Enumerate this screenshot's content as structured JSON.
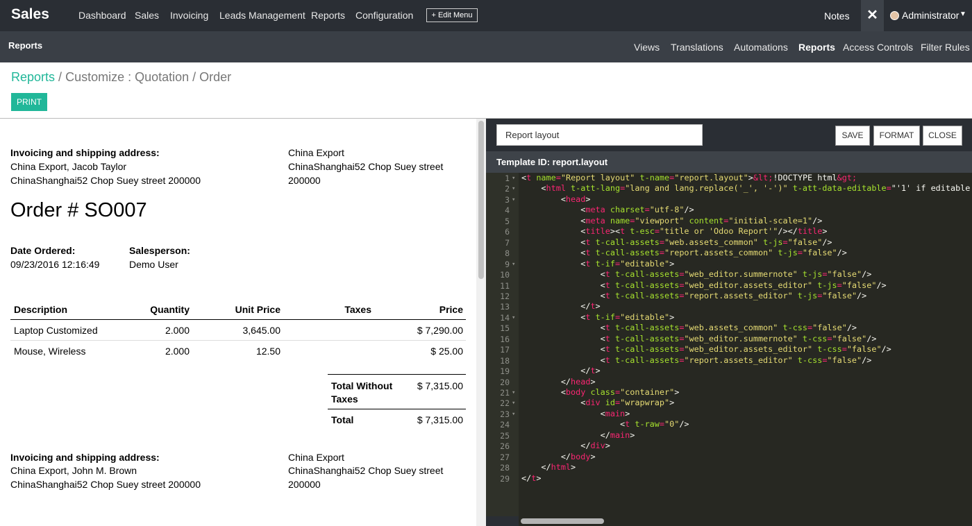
{
  "topbar": {
    "app_title": "Sales",
    "menu": [
      "Dashboard",
      "Sales",
      "Invoicing",
      "Leads Management",
      "Reports",
      "Configuration"
    ],
    "edit_menu": "+ Edit Menu",
    "notes": "Notes",
    "close_symbol": "✕",
    "user": "Administrator"
  },
  "subbar": {
    "title": "Reports",
    "menu": [
      "Views",
      "Translations",
      "Automations",
      "Reports",
      "Access Controls",
      "Filter Rules"
    ],
    "active": "Reports"
  },
  "breadcrumb": {
    "link": "Reports",
    "sep": "/",
    "rest": "Customize : Quotation / Order"
  },
  "print_label": "PRINT",
  "document": {
    "address1": {
      "heading": "Invoicing and shipping address:",
      "line1": "China Export, Jacob Taylor",
      "line2": "ChinaShanghai52 Chop Suey street 200000",
      "right1": "China Export",
      "right2": "ChinaShanghai52 Chop Suey street",
      "right3": "200000"
    },
    "order_title": "Order # SO007",
    "date_label": "Date Ordered:",
    "date_value": "09/23/2016 12:16:49",
    "salesperson_label": "Salesperson:",
    "salesperson_value": "Demo User",
    "table": {
      "headers": [
        "Description",
        "Quantity",
        "Unit Price",
        "Taxes",
        "Price"
      ],
      "rows": [
        [
          "Laptop Customized",
          "2.000",
          "3,645.00",
          "",
          "$ 7,290.00"
        ],
        [
          "Mouse, Wireless",
          "2.000",
          "12.50",
          "",
          "$ 25.00"
        ]
      ]
    },
    "totals": {
      "without_taxes_label_1": "Total Without",
      "without_taxes_label_2": "Taxes",
      "without_taxes_value": "$ 7,315.00",
      "total_label": "Total",
      "total_value": "$ 7,315.00"
    },
    "address2": {
      "heading": "Invoicing and shipping address:",
      "line1": "China Export, John M. Brown",
      "line2": "ChinaShanghai52 Chop Suey street 200000",
      "right1": "China Export",
      "right2": "ChinaShanghai52 Chop Suey street",
      "right3": "200000"
    }
  },
  "editor": {
    "layout_input_value": "Report layout",
    "buttons": [
      "SAVE",
      "FORMAT",
      "CLOSE"
    ],
    "template_id": "Template ID: report.layout",
    "code_lines": [
      "<t name=\"Report layout\" t-name=\"report.layout\">&lt;!DOCTYPE html&gt;",
      "    <html t-att-lang=\"lang and lang.replace('_', '-')\" t-att-data-editable=\"'1' if editable e",
      "        <head>",
      "            <meta charset=\"utf-8\"/>",
      "            <meta name=\"viewport\" content=\"initial-scale=1\"/>",
      "            <title><t t-esc=\"title or 'Odoo Report'\"/></title>",
      "            <t t-call-assets=\"web.assets_common\" t-js=\"false\"/>",
      "            <t t-call-assets=\"report.assets_common\" t-js=\"false\"/>",
      "            <t t-if=\"editable\">",
      "                <t t-call-assets=\"web_editor.summernote\" t-js=\"false\"/>",
      "                <t t-call-assets=\"web_editor.assets_editor\" t-js=\"false\"/>",
      "                <t t-call-assets=\"report.assets_editor\" t-js=\"false\"/>",
      "            </t>",
      "            <t t-if=\"editable\">",
      "                <t t-call-assets=\"web.assets_common\" t-css=\"false\"/>",
      "                <t t-call-assets=\"web_editor.summernote\" t-css=\"false\"/>",
      "                <t t-call-assets=\"web_editor.assets_editor\" t-css=\"false\"/>",
      "                <t t-call-assets=\"report.assets_editor\" t-css=\"false\"/>",
      "            </t>",
      "        </head>",
      "        <body class=\"container\">",
      "            <div id=\"wrapwrap\">",
      "                <main>",
      "                    <t t-raw=\"0\"/>",
      "                </main>",
      "            </div>",
      "        </body>",
      "    </html>",
      "</t>"
    ],
    "fold_lines": [
      1,
      2,
      3,
      9,
      14,
      21,
      22,
      23
    ]
  }
}
